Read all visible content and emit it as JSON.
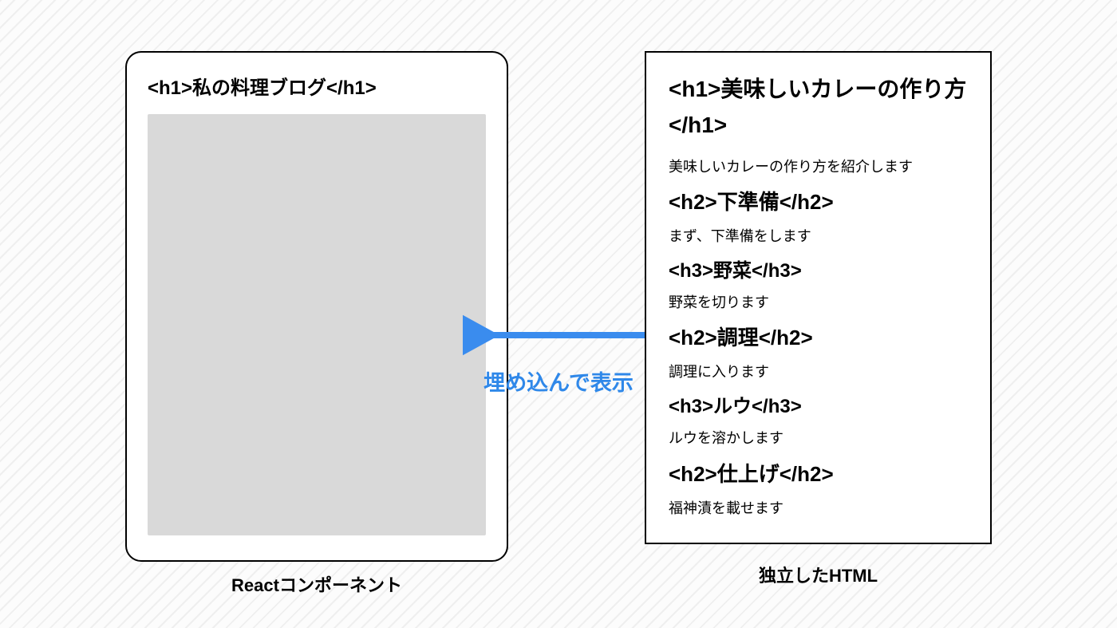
{
  "left": {
    "heading": "<h1>私の料理ブログ</h1>",
    "caption": "Reactコンポーネント"
  },
  "arrow": {
    "label": "埋め込んで表示",
    "color": "#3a8cee"
  },
  "right": {
    "caption": "独立したHTML",
    "content": [
      {
        "tag": "h1",
        "text": "<h1>美味しいカレーの作り方</h1>"
      },
      {
        "tag": "p",
        "text": "美味しいカレーの作り方を紹介します"
      },
      {
        "tag": "h2",
        "text": "<h2>下準備</h2>"
      },
      {
        "tag": "p",
        "text": "まず、下準備をします"
      },
      {
        "tag": "h3",
        "text": "<h3>野菜</h3>"
      },
      {
        "tag": "p",
        "text": "野菜を切ります"
      },
      {
        "tag": "h2",
        "text": "<h2>調理</h2>"
      },
      {
        "tag": "p",
        "text": "調理に入ります"
      },
      {
        "tag": "h3",
        "text": "<h3>ルウ</h3>"
      },
      {
        "tag": "p",
        "text": "ルウを溶かします"
      },
      {
        "tag": "h2",
        "text": "<h2>仕上げ</h2>"
      },
      {
        "tag": "p",
        "text": "福神漬を載せます"
      }
    ]
  }
}
